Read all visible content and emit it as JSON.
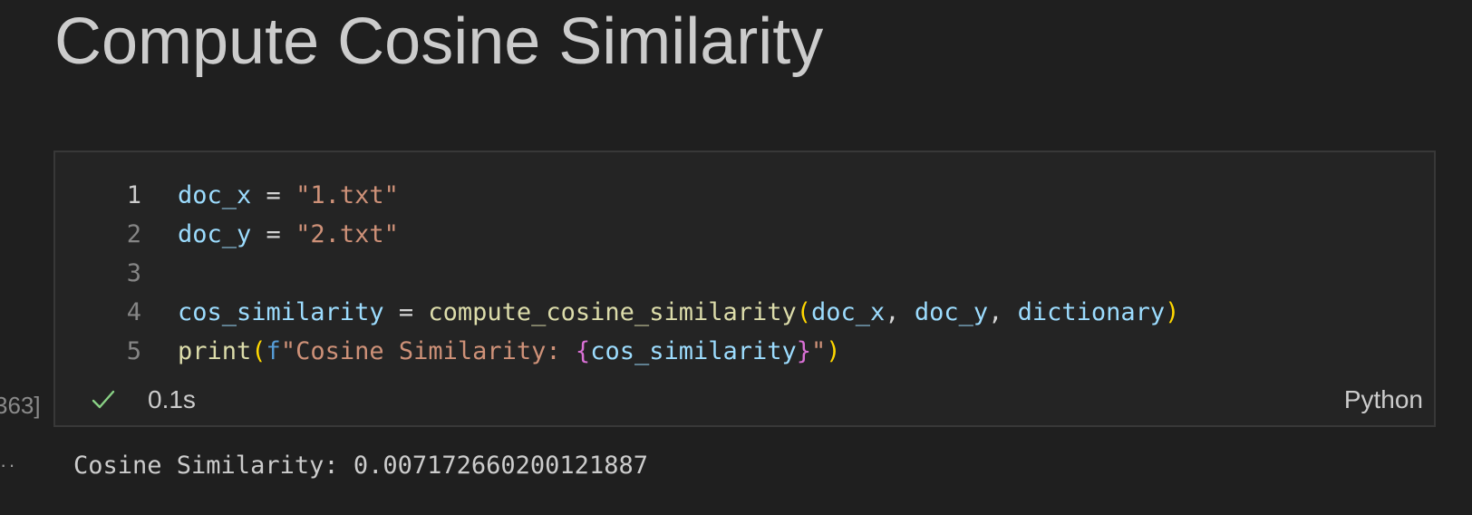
{
  "notebook": {
    "heading": "Compute Cosine Similarity"
  },
  "cell": {
    "execution_count": "363]",
    "status_icon": "check-icon",
    "execution_time": "0.1s",
    "language": "Python",
    "lines": [
      {
        "number": "1",
        "tokens": [
          {
            "text": "doc_x",
            "kind": "var"
          },
          {
            "text": " = ",
            "kind": "op"
          },
          {
            "text": "\"1.txt\"",
            "kind": "str"
          }
        ]
      },
      {
        "number": "2",
        "tokens": [
          {
            "text": "doc_y",
            "kind": "var"
          },
          {
            "text": " = ",
            "kind": "op"
          },
          {
            "text": "\"2.txt\"",
            "kind": "str"
          }
        ]
      },
      {
        "number": "3",
        "tokens": []
      },
      {
        "number": "4",
        "tokens": [
          {
            "text": "cos_similarity",
            "kind": "var"
          },
          {
            "text": " = ",
            "kind": "op"
          },
          {
            "text": "compute_cosine_similarity",
            "kind": "fn"
          },
          {
            "text": "(",
            "kind": "br1"
          },
          {
            "text": "doc_x",
            "kind": "var"
          },
          {
            "text": ", ",
            "kind": "op"
          },
          {
            "text": "doc_y",
            "kind": "var"
          },
          {
            "text": ", ",
            "kind": "op"
          },
          {
            "text": "dictionary",
            "kind": "var"
          },
          {
            "text": ")",
            "kind": "br1"
          }
        ]
      },
      {
        "number": "5",
        "tokens": [
          {
            "text": "print",
            "kind": "fn"
          },
          {
            "text": "(",
            "kind": "br1"
          },
          {
            "text": "f",
            "kind": "kw"
          },
          {
            "text": "\"Cosine Similarity: ",
            "kind": "str"
          },
          {
            "text": "{",
            "kind": "br2"
          },
          {
            "text": "cos_similarity",
            "kind": "var"
          },
          {
            "text": "}",
            "kind": "br2"
          },
          {
            "text": "\"",
            "kind": "str"
          },
          {
            "text": ")",
            "kind": "br1"
          }
        ]
      }
    ]
  },
  "output": {
    "menu_icon": "ellipsis-icon",
    "menu_glyph": "··",
    "text": "Cosine Similarity: 0.007172660200121887"
  },
  "colors": {
    "background": "#1f1f1f",
    "cell_background": "#242424",
    "cell_border": "#383838",
    "variable": "#9cdcfe",
    "string": "#ce9178",
    "function": "#dcdcaa",
    "keyword": "#569cd6",
    "bracket_level1": "#ffd700",
    "bracket_level2": "#da70d6",
    "success": "#89d185"
  }
}
